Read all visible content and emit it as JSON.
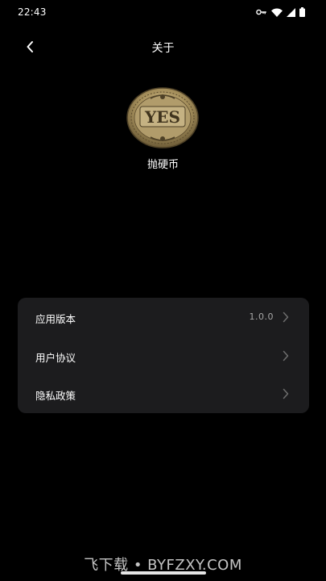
{
  "status_bar": {
    "time": "22:43",
    "icons": [
      "vpn-key-icon",
      "wifi-icon",
      "cellular-signal-icon",
      "battery-icon"
    ]
  },
  "nav": {
    "title": "关于",
    "back_icon": "chevron-left-icon"
  },
  "app": {
    "logo_text": "YES",
    "name": "抛硬币"
  },
  "settings": {
    "items": [
      {
        "label": "应用版本",
        "value": "1.0.0"
      },
      {
        "label": "用户协议"
      },
      {
        "label": "隐私政策"
      }
    ]
  },
  "watermark": "飞下载 • BYFZXY.COM",
  "colors": {
    "background": "#000000",
    "card": "#1c1c1e",
    "text_primary": "#ffffff",
    "text_secondary": "#a6a6a6",
    "coin_gold": "#c9b27a"
  }
}
